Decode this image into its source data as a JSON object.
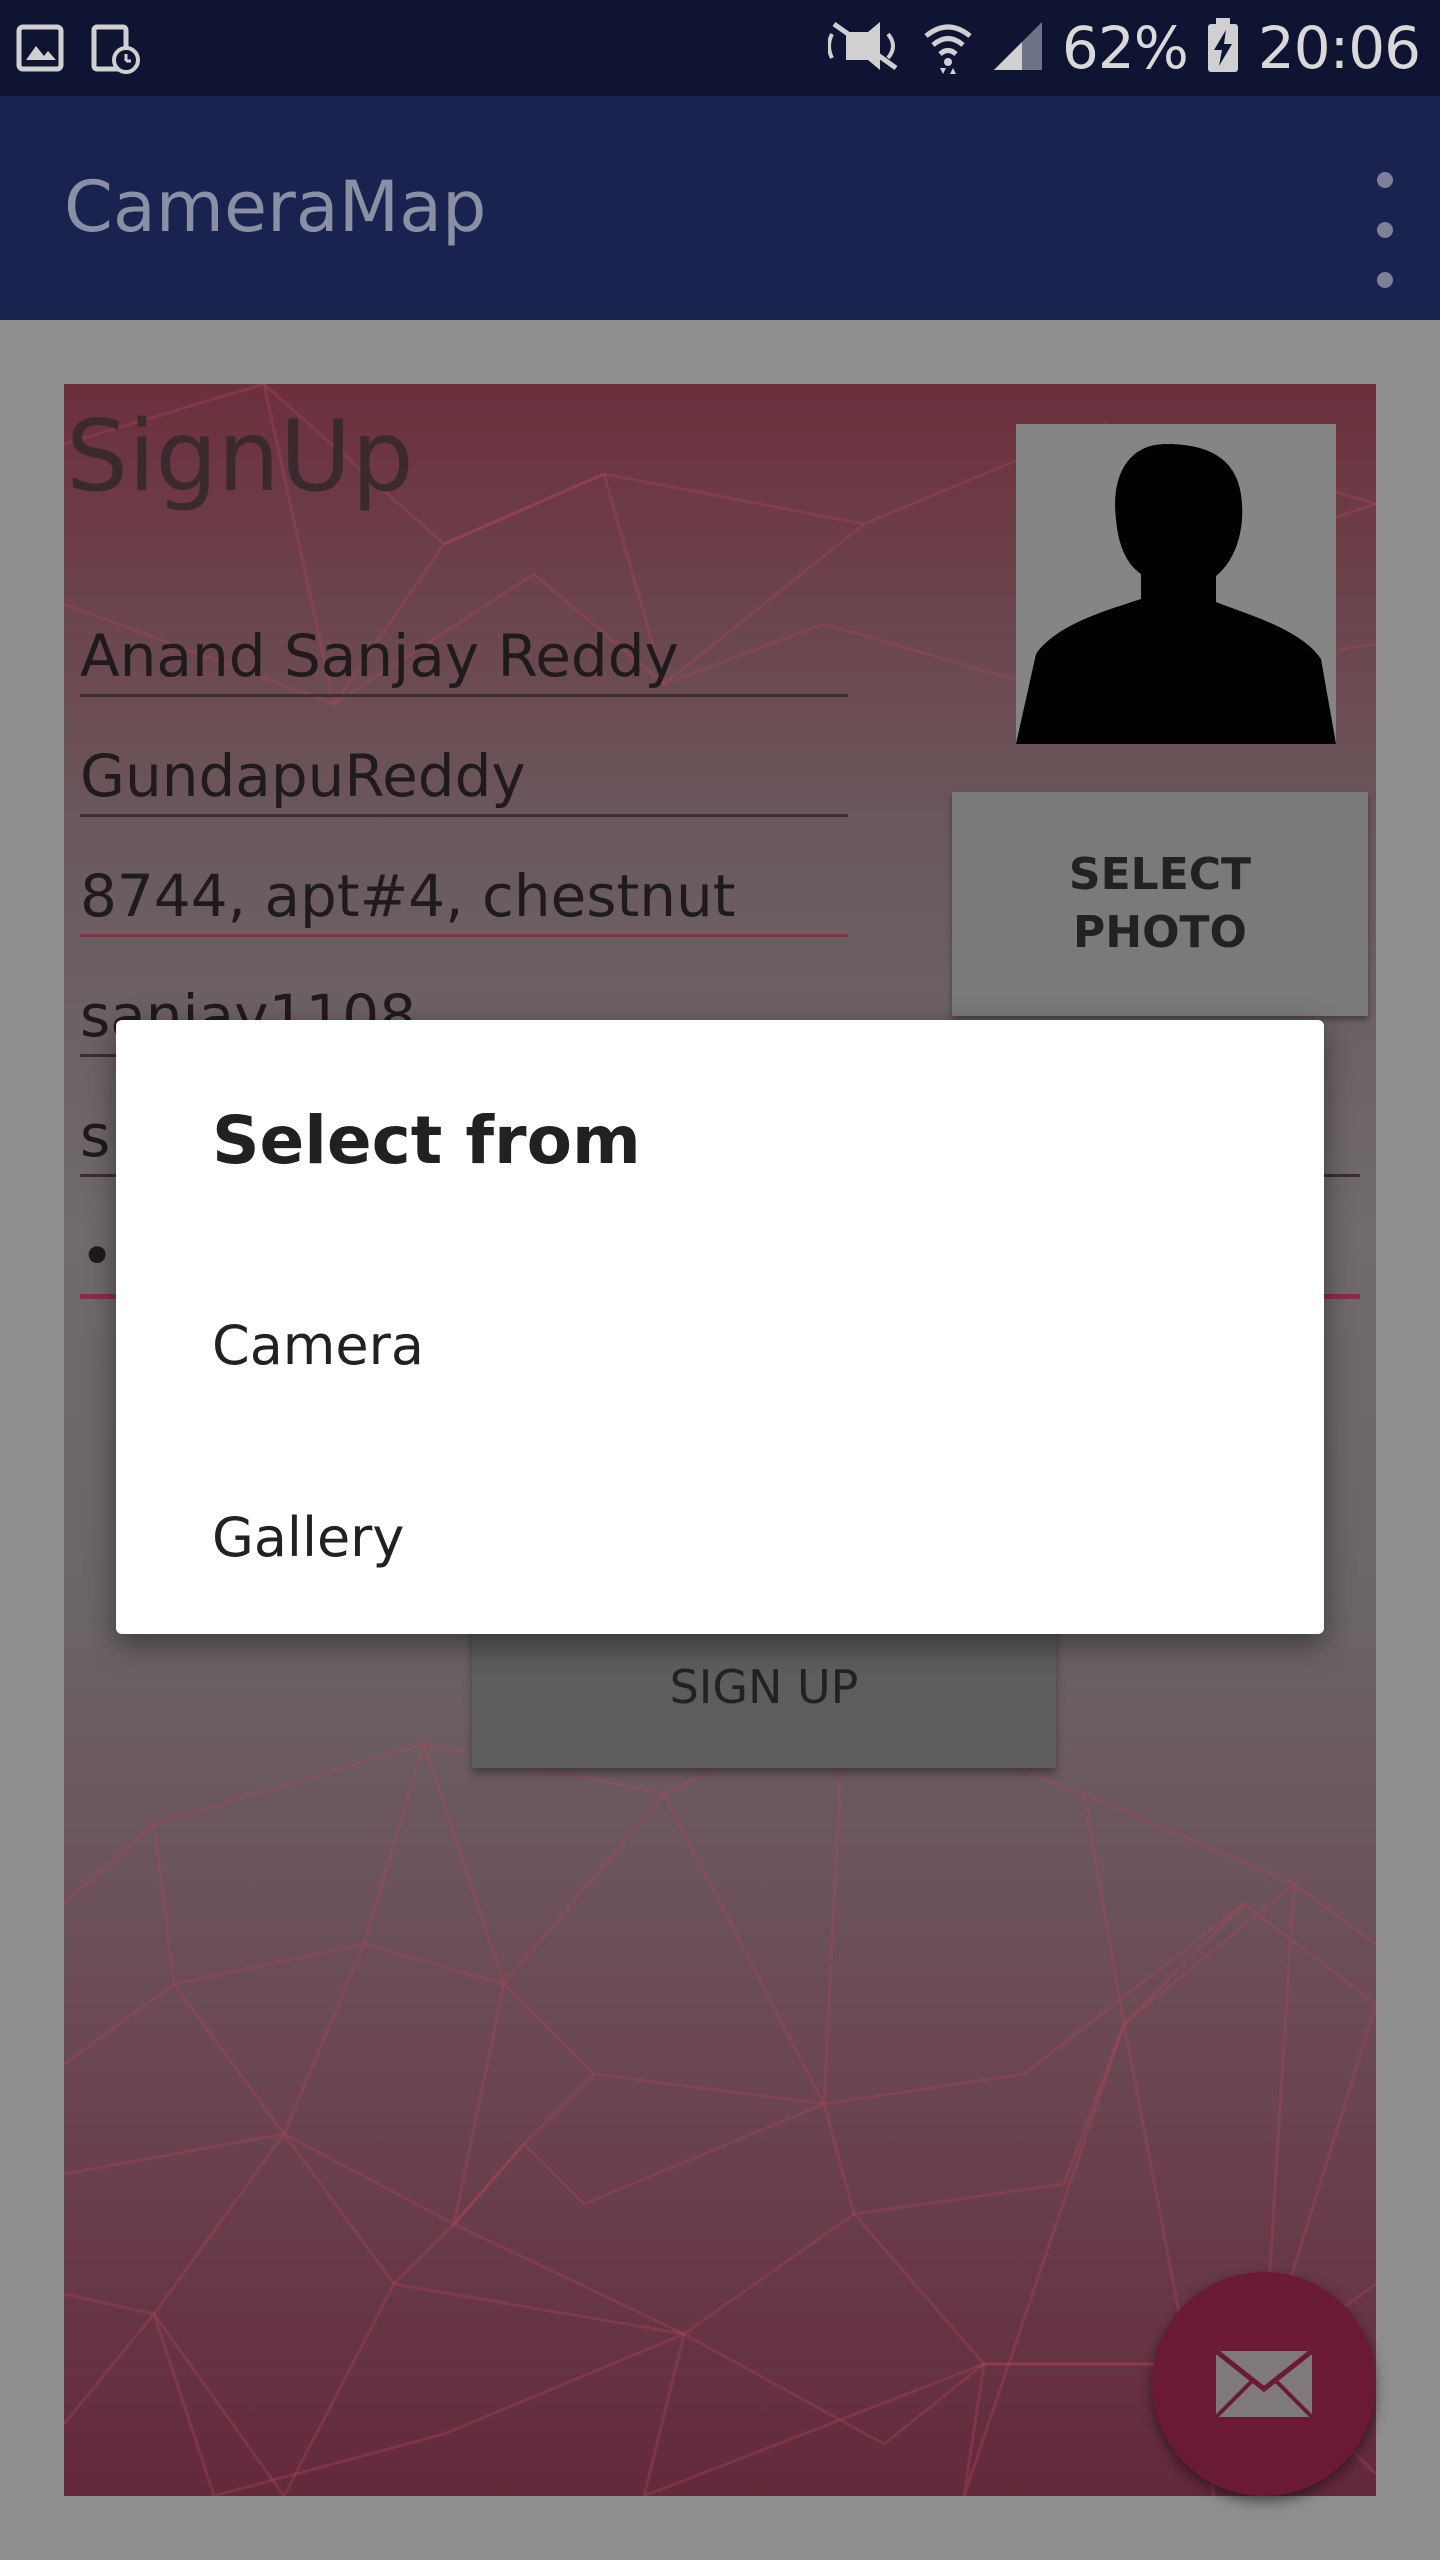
{
  "status_bar": {
    "battery": "62%",
    "time": "20:06",
    "icons": [
      "gallery-icon",
      "screenshot-icon",
      "mute-icon",
      "wifi-icon",
      "signal-icon",
      "battery-charging-icon"
    ]
  },
  "app_bar": {
    "title": "CameraMap",
    "menu_icon": "overflow-menu-icon"
  },
  "form": {
    "title": "SignUp",
    "fields": [
      {
        "value": "Anand Sanjay Reddy"
      },
      {
        "value": "GundapuReddy"
      },
      {
        "value": "8744, apt#4, chestnut"
      },
      {
        "value": "sanjay1108"
      },
      {
        "value": "s"
      },
      {
        "value": "••"
      }
    ],
    "select_photo_label": "SELECT\nPHOTO",
    "sign_up_label": "SIGN UP",
    "fab_icon": "email-icon"
  },
  "dialog": {
    "title": "Select from",
    "options": [
      "Camera",
      "Gallery"
    ]
  },
  "colors": {
    "status_bar": "#0f1433",
    "app_bar": "#1a2350",
    "fab": "#6a1b33",
    "dialog_bg": "#ffffff"
  }
}
